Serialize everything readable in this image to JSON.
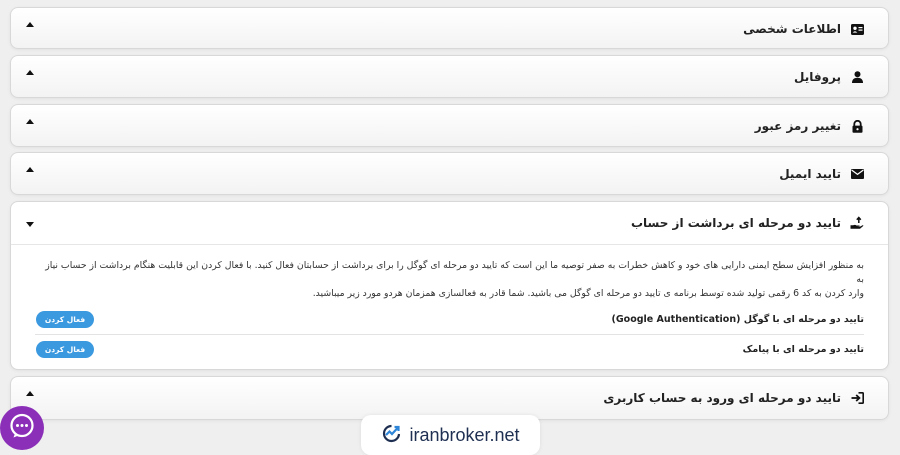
{
  "sections": [
    {
      "title": "اطلاعات شخصی",
      "icon": "id-card-icon",
      "expanded": false
    },
    {
      "title": "پروفایل",
      "icon": "user-icon",
      "expanded": false
    },
    {
      "title": "تغییر رمز عبور",
      "icon": "lock-icon",
      "expanded": false
    },
    {
      "title": "تایید ایمیل",
      "icon": "envelope-icon",
      "expanded": false
    },
    {
      "title": "تایید دو مرحله ای برداشت از حساب",
      "icon": "hand-withdraw-icon",
      "expanded": true,
      "description_lines": [
        "به منظور افزایش سطح ایمنی دارایی های خود و کاهش خطرات به صفر توصیه ما این است که تایید دو مرحله ای گوگل را برای برداشت از حسابتان فعال کنید. با فعال کردن این قابلیت هنگام برداشت از حساب نیاز به",
        "وارد کردن به کد 6 رقمی تولید شده توسط برنامه ی تایید دو مرحله ای گوگل می باشید. شما قادر به فعالسازی همزمان هردو مورد زیر میباشید."
      ],
      "options": [
        {
          "label": "تایید دو مرحله ای با گوگل (Google Authentication)",
          "button": "فعال کردن"
        },
        {
          "label": "تایید دو مرحله ای با پیامک",
          "button": "فعال کردن"
        }
      ]
    },
    {
      "title": "تایید دو مرحله ای ورود به حساب کاربری",
      "icon": "sign-in-icon",
      "expanded": false
    }
  ],
  "brand": {
    "name": "iranbroker.net",
    "icon": "growth-chart-logo-icon"
  },
  "chat": {
    "icon": "chat-bubble-icon",
    "color": "#8b2fb8"
  },
  "colors": {
    "accent": "#3b99e0",
    "background": "#efefef"
  }
}
